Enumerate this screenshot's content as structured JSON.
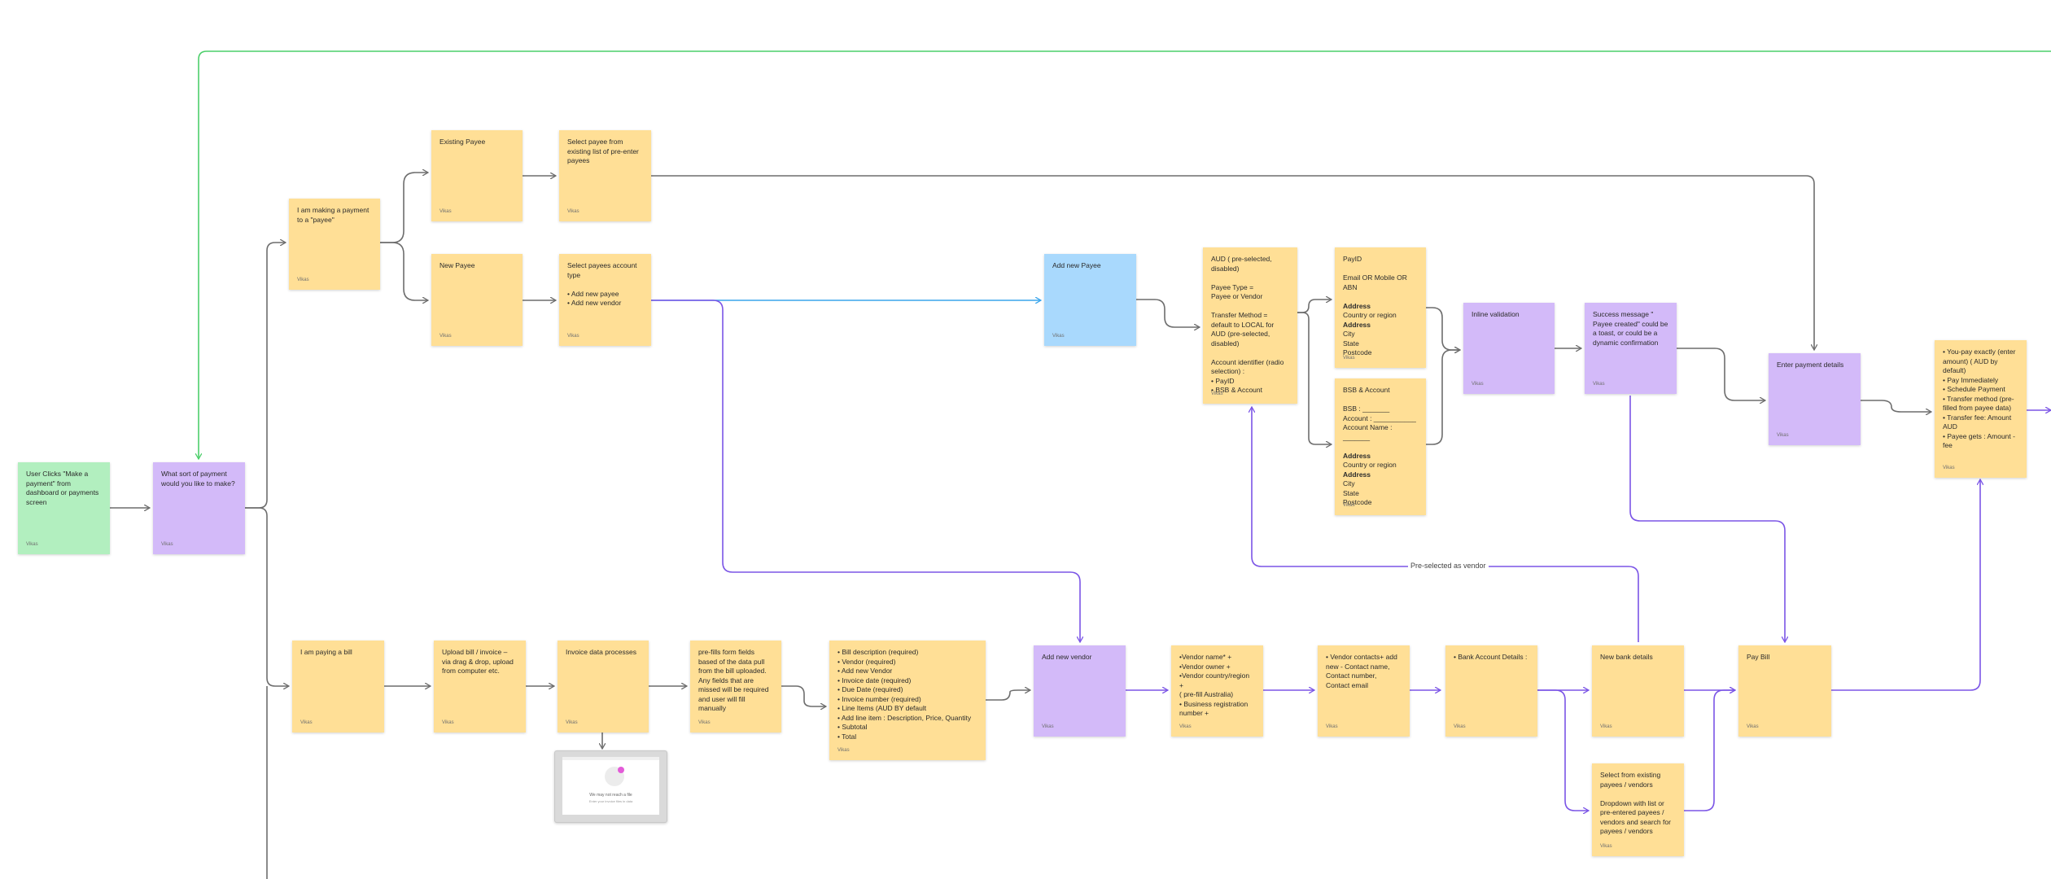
{
  "colors": {
    "sticky_yellow": "#ffdf96",
    "sticky_purple": "#d3baf9",
    "sticky_green": "#b2efbf",
    "sticky_blue": "#a9d9fd",
    "connector_gray": "#6d6d6d",
    "connector_purple": "#7b55e6",
    "connector_blue": "#3aa5ec",
    "connector_green": "#4ccf6a"
  },
  "stickies": {
    "start": {
      "text": "User Clicks \"Make a payment\" from dashboard or payments screen",
      "author": "Vikas"
    },
    "payment_type": {
      "text": "What sort of payment would you like to make?",
      "author": "Vikas"
    },
    "payee": {
      "text": "I am making a payment to a \"payee\"",
      "author": "Vikas"
    },
    "existing_payee": {
      "text": "Existing Payee",
      "author": "Vikas"
    },
    "select_payee": {
      "text": "Select payee from existing list of pre-enter payees",
      "author": "Vikas"
    },
    "new_payee": {
      "text": "New Payee",
      "author": "Vikas"
    },
    "select_account_type": {
      "text": "Select payees account type\n\n• Add new payee\n• Add new vendor",
      "author": "Vikas"
    },
    "add_new_payee": {
      "text": "Add new Payee",
      "author": "Vikas"
    },
    "aud_details": {
      "text": "AUD ( pre-selected, disabled)\n\nPayee Type =\nPayee or Vendor\n\nTransfer Method = default to LOCAL for AUD (pre-selected, disabled)\n\nAccount identifier (radio selection) :\n• PayID\n• BSB & Account",
      "author": "Vikas"
    },
    "payid": {
      "text": "PayID\n\nEmail OR Mobile OR ABN\n\nAddress\nCountry or region\nAddress\nCity\nState\nPostcode",
      "bold": "Address",
      "author": "Vikas"
    },
    "bsb_account": {
      "text": "BSB & Account\n\nBSB : _______\nAccount : ___________\nAccount Name : _______\n\nAddress\nCountry or region\nAddress\nCity\nState\nPostcode",
      "bold": "Address",
      "author": "Vikas"
    },
    "inline_validation": {
      "text": "Inline validation",
      "author": "Vikas"
    },
    "success_message": {
      "text": "Success message \" Payee created\" could be a toast, or could be a dynamic confirmation",
      "author": "Vikas"
    },
    "enter_payment_details": {
      "text": "Enter payment details",
      "author": "Vikas"
    },
    "payment_options": {
      "text": "• You-pay exactly (enter amount) ( AUD by default)\n• Pay Immediately\n• Schedule Payment\n• Transfer method (pre-filled from payee data)\n• Transfer fee: Amount AUD\n• Payee gets : Amount - fee",
      "author": "Vikas"
    },
    "paying_bill": {
      "text": "I am paying a bill",
      "author": "Vikas"
    },
    "upload_bill": {
      "text": "Upload bill / invoice – via drag & drop, upload from computer etc.",
      "author": "Vikas"
    },
    "invoice_processes": {
      "text": "Invoice data processes",
      "author": "Vikas"
    },
    "prefill": {
      "text": "pre-fills form fields based of the data pull from the bill uploaded. Any fields that are missed will be required and user will fill manually",
      "author": "Vikas"
    },
    "bill_fields": {
      "text": "• Bill description (required)\n• Vendor (required)\n• Add new Vendor\n   • Invoice date (required)\n      • Due Date (required)\n   • Invoice number (required)\n• Line Items (AUD BY default\n   • Add line item : Description, Price, Quantity\n   • Subtotal\n• Total",
      "author": "Vikas"
    },
    "add_new_vendor": {
      "text": "Add new vendor",
      "author": "Vikas"
    },
    "vendor_name": {
      "text": "•Vendor name* +\n•Vendor owner +\n•Vendor country/region +\n( pre-fill Australia)\n• Business registration number +",
      "author": "Vikas"
    },
    "vendor_contacts": {
      "text": "• Vendor contacts+ add new - Contact name, Contact number, Contact email",
      "author": "Vikas"
    },
    "bank_details": {
      "text": "• Bank Account Details :",
      "author": "Vikas"
    },
    "new_bank_details": {
      "text": "New bank details",
      "author": "Vikas"
    },
    "pay_bill": {
      "text": "Pay Bill",
      "author": "Vikas"
    },
    "select_existing": {
      "text": "Select from existing payees / vendors\n\nDropdown with list or pre-entered payees / vendors and search for payees / vendors",
      "author": "Vikas"
    }
  },
  "edge_labels": {
    "preselected_vendor": "Pre-selected as vendor"
  },
  "thumbnail": {
    "line1": "We may not reach a file",
    "line2": "Enter your invoice files in data"
  }
}
